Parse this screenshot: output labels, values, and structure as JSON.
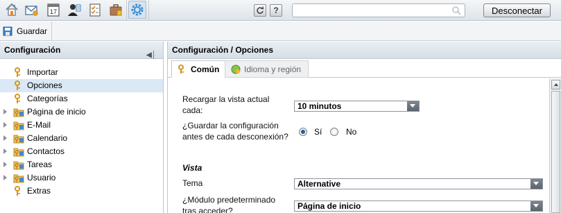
{
  "topbar": {
    "apps": [
      {
        "icon": "home-icon"
      },
      {
        "icon": "email-icon"
      },
      {
        "icon": "calendar-icon"
      },
      {
        "icon": "contacts-icon"
      },
      {
        "icon": "tasks-icon"
      },
      {
        "icon": "briefcase-icon"
      },
      {
        "icon": "settings-gear-icon",
        "active": true
      }
    ],
    "calendar_day": "17",
    "refresh_icon": "refresh-icon",
    "help_label": "?",
    "search": {
      "value": "",
      "placeholder": ""
    },
    "logout_label": "Desconectar"
  },
  "toolbar": {
    "save_label": "Guardar"
  },
  "left": {
    "title": "Configuración",
    "tree": [
      {
        "label": "Importar",
        "expandable": false,
        "icon": "key-icon"
      },
      {
        "label": "Opciones",
        "expandable": false,
        "icon": "key-icon",
        "selected": true
      },
      {
        "label": "Categorías",
        "expandable": false,
        "icon": "key-icon"
      },
      {
        "label": "Página de inicio",
        "expandable": true,
        "icon": "folder-key-icon"
      },
      {
        "label": "E-Mail",
        "expandable": true,
        "icon": "folder-key-icon"
      },
      {
        "label": "Calendario",
        "expandable": true,
        "icon": "folder-key-icon"
      },
      {
        "label": "Contactos",
        "expandable": true,
        "icon": "folder-key-icon"
      },
      {
        "label": "Tareas",
        "expandable": true,
        "icon": "folder-key-icon"
      },
      {
        "label": "Usuario",
        "expandable": true,
        "icon": "folder-key-icon"
      },
      {
        "label": "Extras",
        "expandable": false,
        "icon": "key-icon"
      }
    ]
  },
  "right": {
    "title": "Configuración / Opciones",
    "tabs": [
      {
        "label": "Común",
        "active": true
      },
      {
        "label": "Idioma y región",
        "active": false
      }
    ],
    "form": {
      "reload_label_1": "Recargar la vista actual",
      "reload_label_2": "cada:",
      "reload_value": "10 minutos",
      "save_config_label_1": "¿Guardar la configuración",
      "save_config_label_2": "antes de cada desconexión?",
      "yes_label": "Sí",
      "no_label": "No",
      "selected_option": "Sí",
      "section_view": "Vista",
      "theme_label": "Tema",
      "theme_value": "Alternative",
      "default_module_label_1": "¿Módulo predeterminado",
      "default_module_label_2": "tras acceder?",
      "default_module_value": "Página de inicio"
    }
  }
}
